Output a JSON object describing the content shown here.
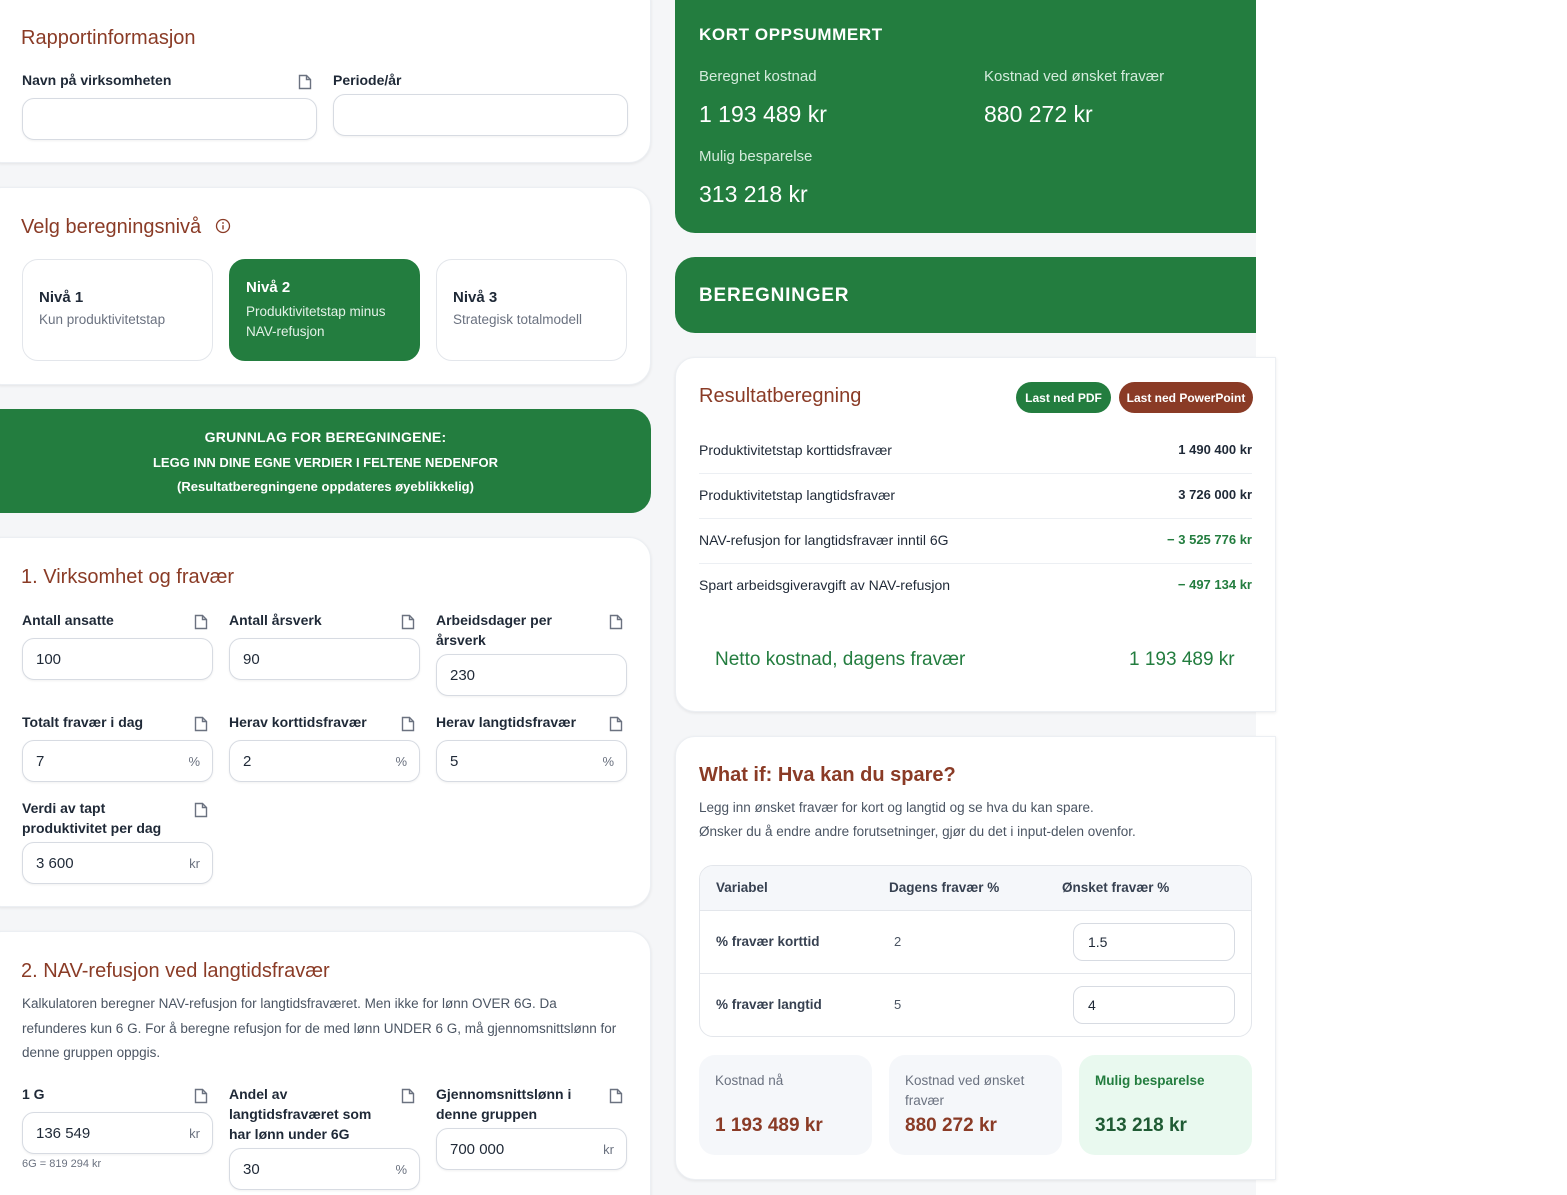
{
  "report_info": {
    "title": "Rapportinformasjon",
    "company_label": "Navn på virksomheten",
    "company_value": "",
    "period_label": "Periode/år",
    "period_value": ""
  },
  "level": {
    "title": "Velg beregningsnivå",
    "options": [
      {
        "title": "Nivå 1",
        "subtitle": "Kun produktivitetstap"
      },
      {
        "title": "Nivå 2",
        "subtitle": "Produktivitetstap minus NAV-refusjon"
      },
      {
        "title": "Nivå 3",
        "subtitle": "Strategisk totalmodell"
      }
    ],
    "selected": 2
  },
  "banner": {
    "line1": "GRUNNLAG FOR BEREGNINGENE:",
    "line2": "LEGG INN DINE EGNE VERDIER I FELTENE NEDENFOR",
    "line3": "(Resultatberegningene oppdateres øyeblikkelig)"
  },
  "section1": {
    "title": "1. Virksomhet og fravær",
    "fields": {
      "employees": {
        "label": "Antall ansatte",
        "value": "100"
      },
      "fte": {
        "label": "Antall årsverk",
        "value": "90"
      },
      "workdays": {
        "label": "Arbeidsdager per årsverk",
        "value": "230"
      },
      "total_absence": {
        "label": "Totalt fravær i dag",
        "value": "7",
        "unit": "%"
      },
      "short_absence": {
        "label": "Herav korttidsfravær",
        "value": "2",
        "unit": "%"
      },
      "long_absence": {
        "label": "Herav langtidsfravær",
        "value": "5",
        "unit": "%"
      },
      "productivity": {
        "label": "Verdi av tapt produktivitet per dag",
        "value": "3 600",
        "unit": "kr"
      }
    }
  },
  "section2": {
    "title": "2. NAV-refusjon ved langtidsfravær",
    "description": "Kalkulatoren beregner NAV-refusjon for langtidsfraværet. Men ikke for lønn OVER 6G. Da refunderes kun 6 G. For å beregne refusjon for de med lønn UNDER 6 G, må gjennomsnittslønn for denne gruppen oppgis.",
    "fields": {
      "g": {
        "label": "1 G",
        "value": "136 549",
        "unit": "kr",
        "hint": "6G = 819 294 kr"
      },
      "share": {
        "label": "Andel av langtidsfraværet som har lønn under 6G",
        "value": "30",
        "unit": "%"
      },
      "avg_salary": {
        "label": "Gjennomsnittslønn i denne gruppen",
        "value": "700 000",
        "unit": "kr"
      }
    }
  },
  "summary": {
    "title": "KORT OPPSUMMERT",
    "calc_cost_label": "Beregnet kostnad",
    "calc_cost_value": "1 193 489 kr",
    "desired_cost_label": "Kostnad ved ønsket fravær",
    "desired_cost_value": "880 272 kr",
    "saving_label": "Mulig besparelse",
    "saving_value": "313 218 kr"
  },
  "calculations": {
    "title": "BEREGNINGER"
  },
  "result": {
    "title": "Resultatberegning",
    "pdf_button": "Last ned PDF",
    "ppt_button": "Last ned PowerPoint",
    "rows": [
      {
        "label": "Produktivitetstap korttidsfravær",
        "value": "1 490 400 kr"
      },
      {
        "label": "Produktivitetstap langtidsfravær",
        "value": "3 726 000 kr"
      },
      {
        "label": "NAV-refusjon for langtidsfravær inntil 6G",
        "value": "− 3 525 776 kr"
      },
      {
        "label": "Spart arbeidsgiveravgift av NAV-refusjon",
        "value": "− 497 134 kr"
      }
    ],
    "net_label": "Netto kostnad, dagens fravær",
    "net_value": "1 193 489 kr"
  },
  "whatif": {
    "title": "What if: Hva kan du spare?",
    "desc1": "Legg inn ønsket fravær for kort og langtid og se hva du kan spare.",
    "desc2": "Ønsker du å endre andre forutsetninger, gjør du det i input-delen ovenfor.",
    "headers": [
      "Variabel",
      "Dagens fravær %",
      "Ønsket fravær %"
    ],
    "rows": [
      {
        "label": "% fravær korttid",
        "current": "2",
        "desired": "1.5"
      },
      {
        "label": "% fravær langtid",
        "current": "5",
        "desired": "4"
      }
    ],
    "tiles": [
      {
        "label": "Kostnad nå",
        "value": "1 193 489 kr"
      },
      {
        "label": "Kostnad ved ønsket fravær",
        "value": "880 272 kr"
      },
      {
        "label": "Mulig besparelse",
        "value": "313 218 kr"
      }
    ]
  },
  "colors": {
    "brand_green": "#237d3f",
    "accent_brown": "#8a3b26"
  }
}
